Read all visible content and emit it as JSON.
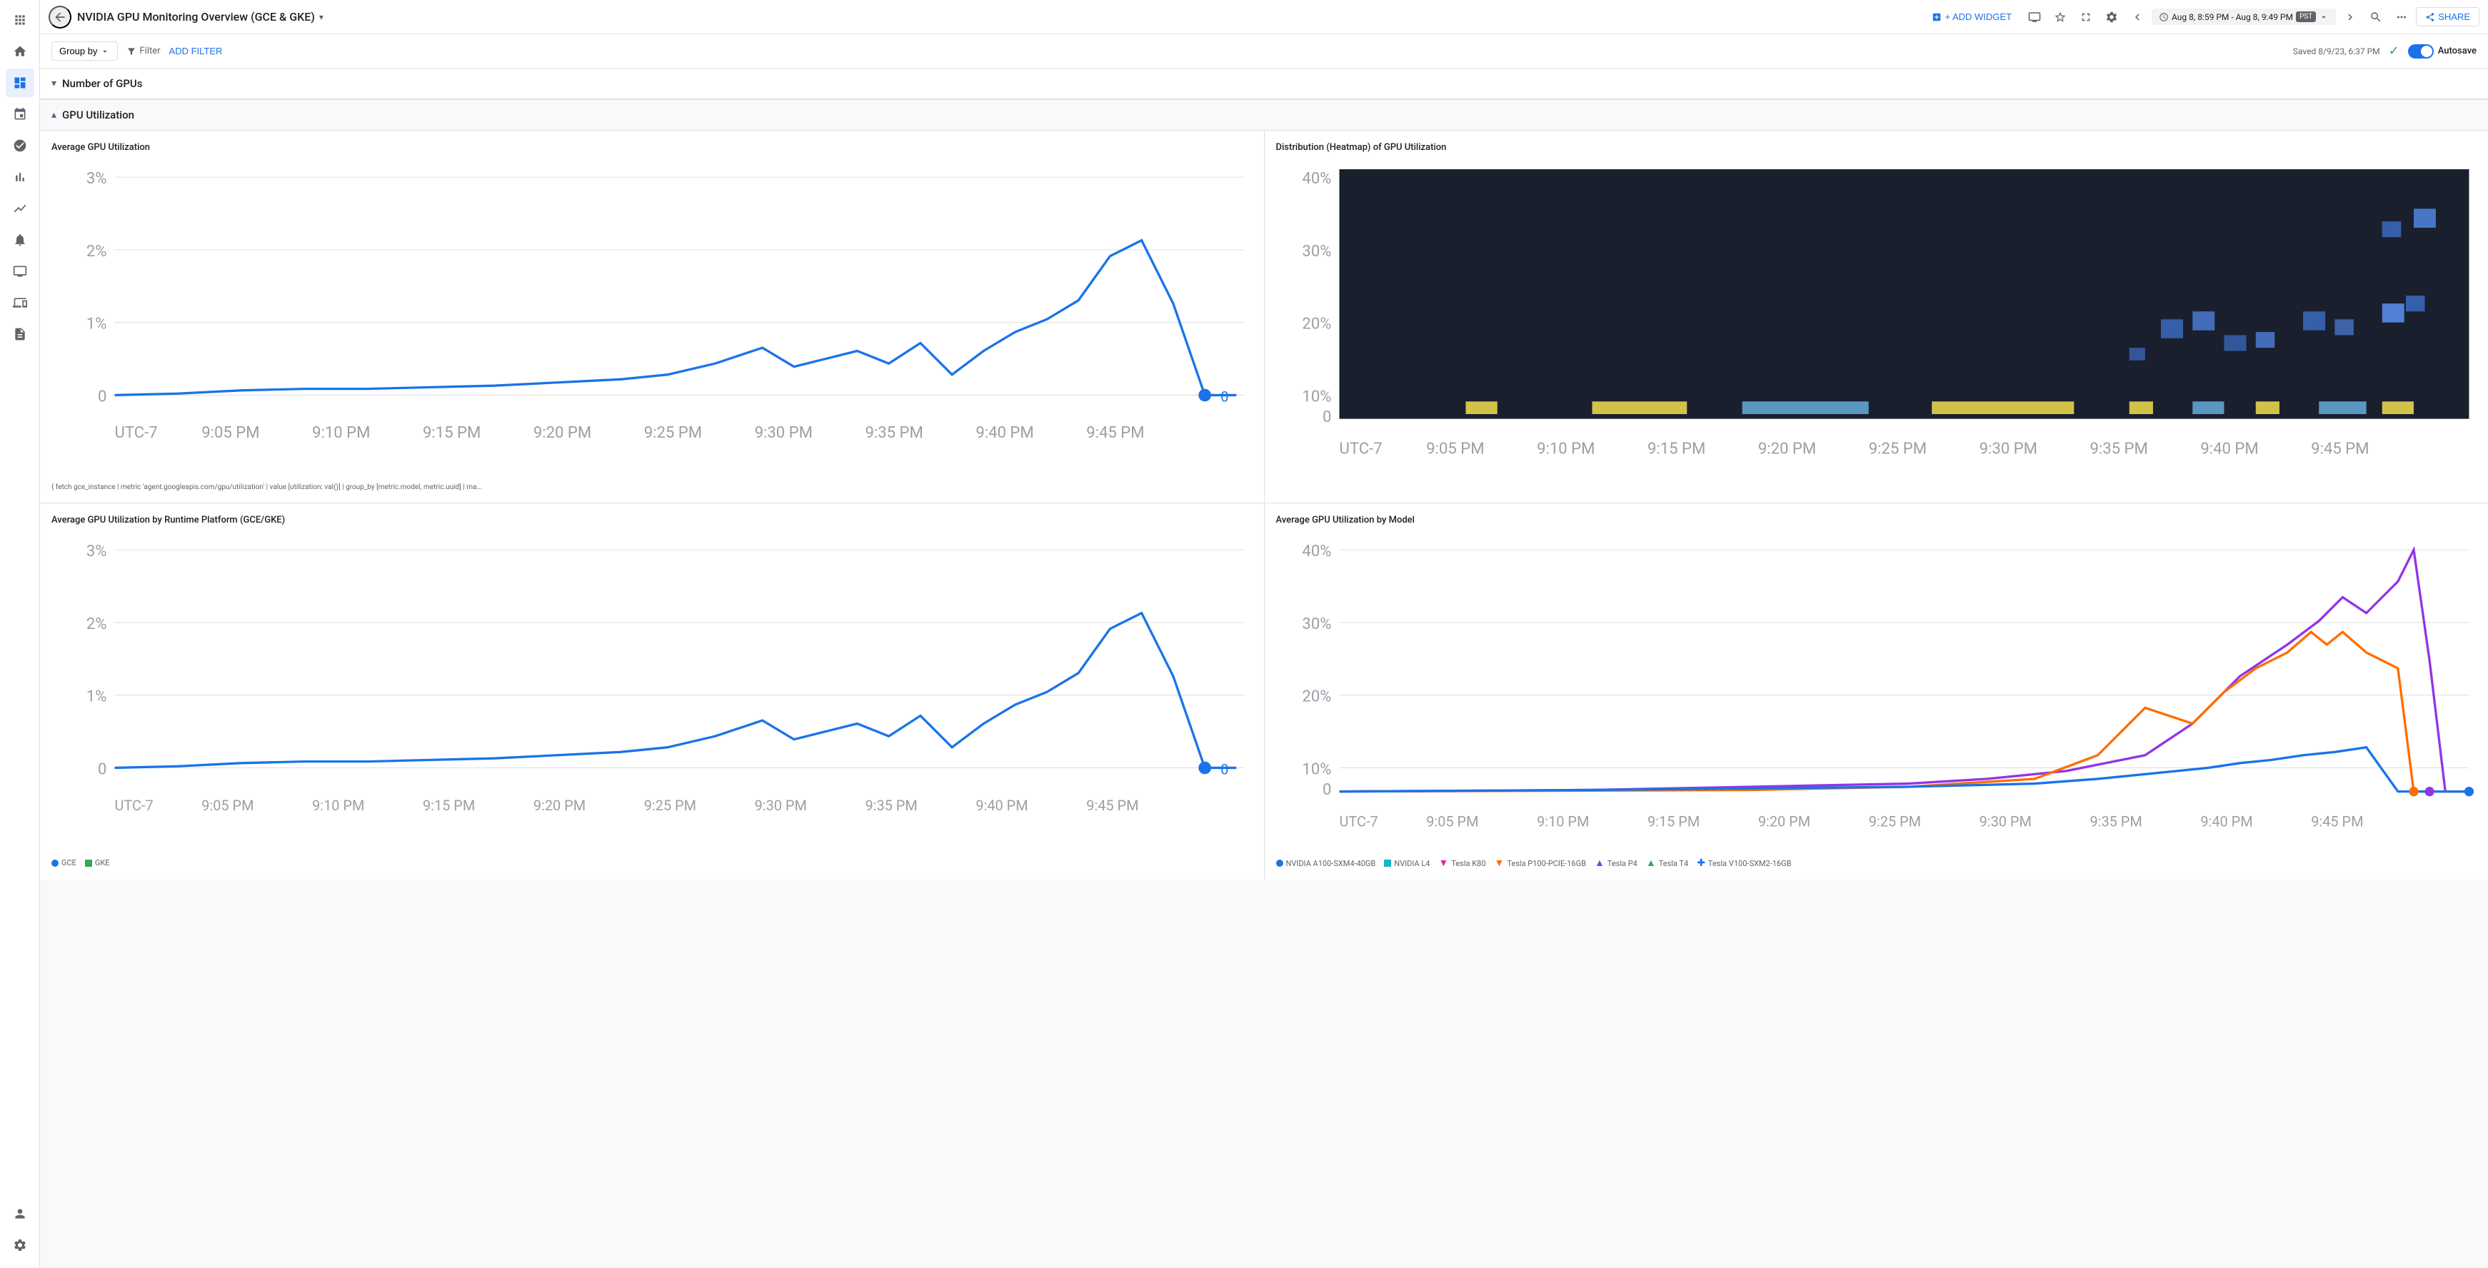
{
  "sidebar": {
    "icons": [
      {
        "name": "apps-icon",
        "symbol": "⊞",
        "active": false
      },
      {
        "name": "dashboard-icon",
        "symbol": "▦",
        "active": false
      },
      {
        "name": "monitoring-icon",
        "symbol": "◼",
        "active": true
      },
      {
        "name": "traces-icon",
        "symbol": "⤢",
        "active": false
      },
      {
        "name": "profiler-icon",
        "symbol": "⊙",
        "active": false
      },
      {
        "name": "chart-icon",
        "symbol": "▊",
        "active": false
      },
      {
        "name": "anomaly-icon",
        "symbol": "∿",
        "active": false
      },
      {
        "name": "alerts-icon",
        "symbol": "🔔",
        "active": false
      },
      {
        "name": "display-icon",
        "symbol": "🖥",
        "active": false
      },
      {
        "name": "compute-icon",
        "symbol": "⬜",
        "active": false
      },
      {
        "name": "logs-icon",
        "symbol": "☰",
        "active": false
      },
      {
        "name": "user-icon",
        "symbol": "👤",
        "active": false
      },
      {
        "name": "settings-icon",
        "symbol": "⚙",
        "active": false
      }
    ]
  },
  "header": {
    "title": "NVIDIA GPU Monitoring Overview (GCE & GKE)",
    "add_widget_label": "+ ADD WIDGET",
    "time_range": "Aug 8, 8:59 PM - Aug 8, 9:49 PM",
    "timezone": "PST",
    "share_label": "SHARE"
  },
  "filter_bar": {
    "group_by_label": "Group by",
    "filter_label": "Filter",
    "add_filter_label": "ADD FILTER",
    "saved_text": "Saved 8/9/23, 6:37 PM",
    "autosave_label": "Autosave"
  },
  "sections": [
    {
      "id": "number-of-gpus",
      "title": "Number of GPUs",
      "collapsed": true
    },
    {
      "id": "gpu-utilization",
      "title": "GPU Utilization",
      "collapsed": false
    }
  ],
  "charts": {
    "avg_gpu_util": {
      "title": "Average GPU Utilization",
      "y_max": "3%",
      "y_mid": "2%",
      "y_low": "1%",
      "y_zero": "0",
      "x_labels": [
        "UTC-7",
        "9:05 PM",
        "9:10 PM",
        "9:15 PM",
        "9:20 PM",
        "9:25 PM",
        "9:30 PM",
        "9:35 PM",
        "9:40 PM",
        "9:45 PM"
      ],
      "footer": "{ fetch gce_instance | metric 'agent.googleapis.com/gpu/utilization' | value [utilization: val()] | group_by [metric.model, metric.uuid] | ma..."
    },
    "heatmap": {
      "title": "Distribution (Heatmap) of GPU Utilization",
      "y_max": "40%",
      "y_30": "30%",
      "y_20": "20%",
      "y_10": "10%",
      "y_zero": "0",
      "x_labels": [
        "UTC-7",
        "9:05 PM",
        "9:10 PM",
        "9:15 PM",
        "9:20 PM",
        "9:25 PM",
        "9:30 PM",
        "9:35 PM",
        "9:40 PM",
        "9:45 PM"
      ]
    },
    "avg_gpu_runtime": {
      "title": "Average GPU Utilization by Runtime Platform (GCE/GKE)",
      "y_max": "3%",
      "y_mid": "2%",
      "y_low": "1%",
      "y_zero": "0",
      "x_labels": [
        "UTC-7",
        "9:05 PM",
        "9:10 PM",
        "9:15 PM",
        "9:20 PM",
        "9:25 PM",
        "9:30 PM",
        "9:35 PM",
        "9:40 PM",
        "9:45 PM"
      ],
      "legend": [
        {
          "label": "GCE",
          "color": "#1a73e8"
        },
        {
          "label": "GKE",
          "color": "#34a853"
        }
      ]
    },
    "avg_gpu_model": {
      "title": "Average GPU Utilization by Model",
      "y_max": "40%",
      "y_30": "30%",
      "y_20": "20%",
      "y_10": "10%",
      "y_zero": "0",
      "x_labels": [
        "UTC-7",
        "9:05 PM",
        "9:10 PM",
        "9:15 PM",
        "9:20 PM",
        "9:25 PM",
        "9:30 PM",
        "9:35 PM",
        "9:40 PM",
        "9:45 PM"
      ],
      "legend": [
        {
          "label": "NVIDIA A100-SXM4-40GB",
          "color": "#1a73e8",
          "shape": "circle"
        },
        {
          "label": "NVIDIA L4",
          "color": "#12b5cb",
          "shape": "square"
        },
        {
          "label": "Tesla K80",
          "color": "#e52592",
          "shape": "triangle-down"
        },
        {
          "label": "Tesla P100-PCIE-16GB",
          "color": "#ff6d00",
          "shape": "triangle-down"
        },
        {
          "label": "Tesla P4",
          "color": "#9334e6",
          "shape": "triangle-up"
        },
        {
          "label": "Tesla T4",
          "color": "#34a853",
          "shape": "triangle-up"
        },
        {
          "label": "Tesla V100-SXM2-16GB",
          "color": "#1a73e8",
          "shape": "plus"
        }
      ]
    }
  }
}
